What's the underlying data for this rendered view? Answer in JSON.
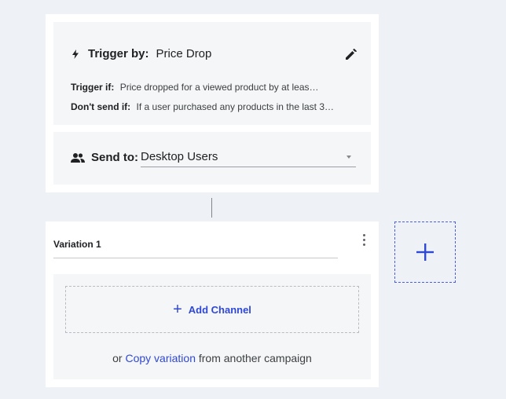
{
  "trigger": {
    "label": "Trigger by:",
    "value": "Price Drop",
    "trigger_if_label": "Trigger if:",
    "trigger_if_text": "Price dropped for a viewed product by at leas…",
    "dont_send_label": "Don't send if:",
    "dont_send_text": "If a user purchased any products in the last 3…"
  },
  "send_to": {
    "label": "Send to:",
    "value": "Desktop Users"
  },
  "variation": {
    "name": "Variation 1",
    "add_channel_label": "Add Channel",
    "copy_prefix": "or",
    "copy_link": "Copy variation",
    "copy_suffix": "from another campaign"
  },
  "colors": {
    "accent": "#2f48d4",
    "background": "#eef2f6",
    "panel": "#f5f6f7"
  },
  "icons": {
    "trigger": "bolt-icon",
    "edit": "pencil-icon",
    "audience": "people-icon",
    "more": "kebab-icon",
    "add": "plus-icon"
  }
}
